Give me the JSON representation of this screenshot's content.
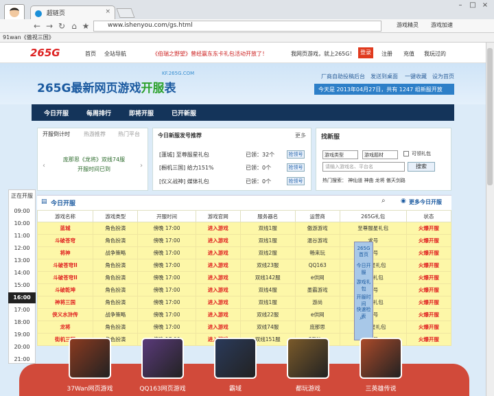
{
  "browser": {
    "tab_title": "超链页",
    "url": "www.ishenyou.com/gs.html",
    "bookmark": "91wan《傲视三国》",
    "toolbar_items": [
      "游戏精灵",
      "游戏加速"
    ]
  },
  "site": {
    "logo": "265G",
    "nav": [
      "首页",
      "全站导航",
      "《伯瑞之野望》曾经赢东东卡礼包活动开放了！",
      "我网页游戏，就上265G！",
      "注册",
      "充值",
      "我玩过的"
    ],
    "register": "登录",
    "banner_title_prefix": "265G最新网页游戏",
    "banner_title_highlight": "开服",
    "banner_title_suffix": "表",
    "banner_sub": "KF.265G.COM",
    "banner_links": [
      "厂商自助投稿后台",
      "发送到桌面",
      "一键收藏",
      "设为首页"
    ],
    "date_text": "今天是 2013年04月27日，共有 1247 组新服开放"
  },
  "navbar": [
    "今日开服",
    "每周排行",
    "即将开服",
    "已开新服"
  ],
  "panel1": {
    "tabs": [
      "开服倒计时",
      "热游推荐",
      "热门平台"
    ],
    "text1": "庞那思《龙将》双线74服",
    "text2": "开服时间已到"
  },
  "panel2": {
    "title": "今日新服发号推荐",
    "more": "更多",
    "rows": [
      {
        "name": "[蓬城] 至尊服星礼包",
        "status": "已领：32个",
        "btn": "抢领号"
      },
      {
        "name": "[橱机三国] 给力151%",
        "status": "已领：0个",
        "btn": "抢领号"
      },
      {
        "name": "[仪义战神] 媒体礼包",
        "status": "已领：0个",
        "btn": "抢领号"
      }
    ]
  },
  "panel3": {
    "title": "找新服",
    "select1": "游戏类型",
    "select2": "游戏题材",
    "checkbox": "可领礼包",
    "search_placeholder": "请输入游戏名、平台名",
    "search_btn": "搜索",
    "hot": "热门搜索：  神仙道  神曲  龙将  傲天剑路"
  },
  "table": {
    "title": "今日开服",
    "more": "更多今日开服",
    "headers": [
      "游戏名称",
      "游戏类型",
      "开服时间",
      "游戏官网",
      "服务器名",
      "运营商",
      "265G礼包",
      "状态"
    ],
    "rows": [
      [
        "蓝城",
        "角色扮演",
        "傍晚 17:00",
        "进入游戏",
        "双线1服",
        "傲游游戏",
        "至尊服星礼包",
        "火爆开服"
      ],
      [
        "斗破苍穹",
        "角色扮演",
        "傍晚 17:00",
        "进入游戏",
        "双线1服",
        "温谷游戏",
        "求号",
        "火爆开服"
      ],
      [
        "将神",
        "战争策略",
        "傍晚 17:00",
        "进入游戏",
        "双线2服",
        "畅来玩",
        "求号",
        "火爆开服"
      ],
      [
        "斗破苍穹II",
        "角色扮演",
        "傍晚 17:00",
        "进入游戏",
        "双线23服",
        "QQ163",
        "新服星礼包",
        "火爆开服"
      ],
      [
        "斗破苍穹II",
        "角色扮演",
        "傍晚 17:00",
        "进入游戏",
        "双线142服",
        "e供网",
        "新服礼包",
        "火爆开服"
      ],
      [
        "斗破乾坤",
        "角色扮演",
        "傍晚 17:00",
        "进入游戏",
        "双线4服",
        "墨霸游戏",
        "求号",
        "火爆开服"
      ],
      [
        "神将三国",
        "角色扮演",
        "傍晚 17:00",
        "进入游戏",
        "双线1服",
        "游尚",
        "新服礼包",
        "火爆开服"
      ],
      [
        "侠义水浒传",
        "战争策略",
        "傍晚 17:00",
        "进入游戏",
        "双线22服",
        "e供网",
        "求号",
        "火爆开服"
      ],
      [
        "龙将",
        "角色扮演",
        "傍晚 17:00",
        "进入游戏",
        "双线74服",
        "庞那思",
        "新服星礼包",
        "火爆开服"
      ],
      [
        "街机三国",
        "角色扮演",
        "傍晚 17:00",
        "进入游戏",
        "双线151服",
        "37Wan",
        "求号",
        "火爆开服"
      ]
    ]
  },
  "times": {
    "label": "正在开服",
    "items": [
      "09:00",
      "10:00",
      "11:00",
      "12:00",
      "13:00",
      "14:00",
      "15:00",
      "16:00",
      "17:00",
      "18:00",
      "19:00",
      "20:00",
      "21:00"
    ],
    "active": "16:00"
  },
  "side_float": [
    "265G首页",
    "今日开服",
    "游戏礼包",
    "开服时间",
    "快速检索"
  ],
  "bottom_games": [
    {
      "label": "37Wan网页游戏",
      "color": "#8a3a20"
    },
    {
      "label": "QQ163网页游戏",
      "color": "#5a3a7a"
    },
    {
      "label": "霸域",
      "color": "#2a3a5a"
    },
    {
      "label": "都玩游戏",
      "color": "#7a5a2a"
    },
    {
      "label": "三英雄传说",
      "color": "#aa4a2a"
    }
  ],
  "colors": {
    "accent": "#14345a",
    "table_row": "#fdf7a8",
    "highlight_red": "#e02020",
    "bottom_bar": "#d14a3a"
  }
}
